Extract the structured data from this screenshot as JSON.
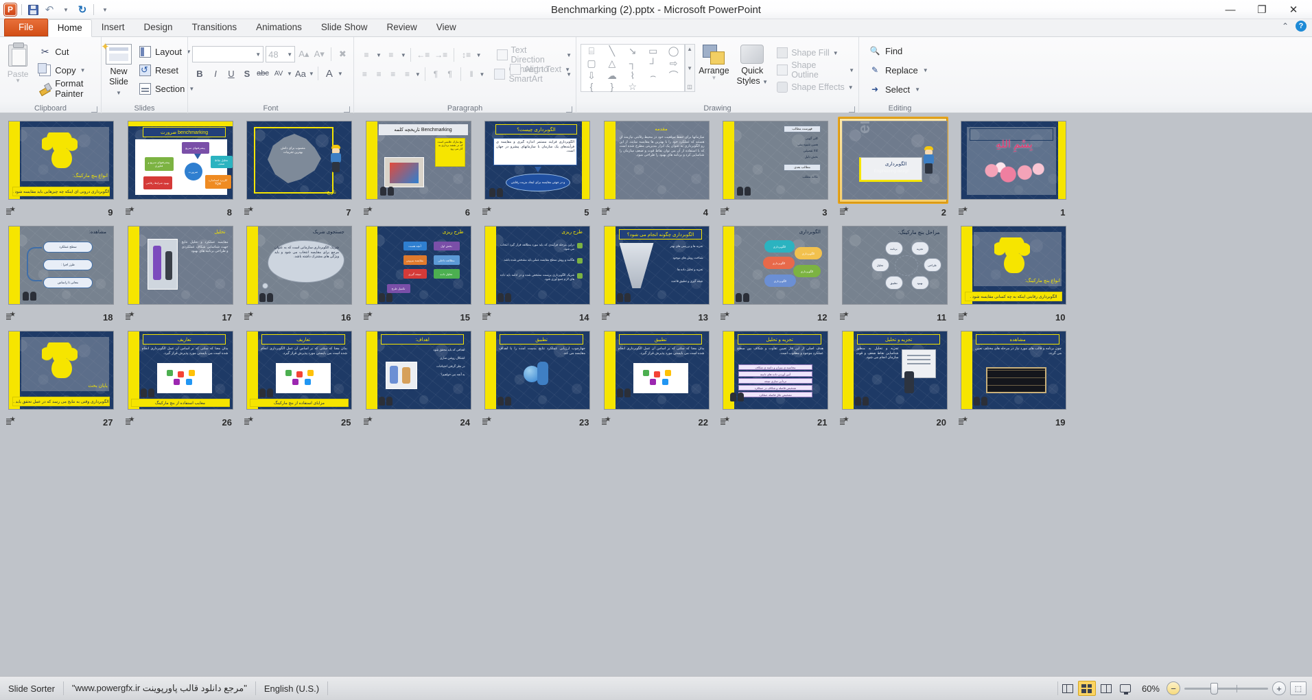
{
  "titlebar": {
    "app_icon": "powerpoint-logo-icon",
    "qat": [
      {
        "name": "save",
        "icon": "save-icon",
        "label": "Save"
      },
      {
        "name": "undo",
        "icon": "undo-icon",
        "label": "Undo"
      },
      {
        "name": "redo",
        "icon": "redo-icon",
        "label": "Repeat"
      },
      {
        "name": "customize",
        "icon": "chevron-down-icon",
        "label": "Customize Quick Access Toolbar"
      }
    ],
    "title": "Benchmarking (2).pptx  -  Microsoft PowerPoint",
    "minimize": "—",
    "restore": "❐",
    "close": "✕",
    "collapse_ribbon": "⌃",
    "help": "?"
  },
  "tabs": [
    {
      "label": "File",
      "active": false,
      "kind": "file"
    },
    {
      "label": "Home",
      "active": true,
      "kind": "normal"
    },
    {
      "label": "Insert",
      "active": false,
      "kind": "normal"
    },
    {
      "label": "Design",
      "active": false,
      "kind": "normal"
    },
    {
      "label": "Transitions",
      "active": false,
      "kind": "normal"
    },
    {
      "label": "Animations",
      "active": false,
      "kind": "normal"
    },
    {
      "label": "Slide Show",
      "active": false,
      "kind": "normal"
    },
    {
      "label": "Review",
      "active": false,
      "kind": "normal"
    },
    {
      "label": "View",
      "active": false,
      "kind": "normal"
    }
  ],
  "ribbon": {
    "groups": {
      "clipboard": {
        "label": "Clipboard",
        "paste": "Paste",
        "cut": "Cut",
        "copy": "Copy",
        "format_painter": "Format Painter"
      },
      "slides": {
        "label": "Slides",
        "new_slide_line1": "New",
        "new_slide_line2": "Slide",
        "layout": "Layout",
        "reset": "Reset",
        "section": "Section"
      },
      "font": {
        "label": "Font",
        "font_name": "",
        "font_size": "48",
        "bold": "B",
        "italic": "I",
        "underline": "U",
        "shadow": "S",
        "strikethrough": "abc",
        "character_spacing": "AV",
        "change_case": "Aa",
        "font_color": "A",
        "increase_size": "A",
        "decrease_size": "A",
        "clear_formatting": "Aa"
      },
      "paragraph": {
        "label": "Paragraph",
        "bullets": "≡",
        "numbering": "≡",
        "decrease_indent": "←≡",
        "increase_indent": "→≡",
        "line_spacing": "↕≡",
        "align_left": "≡",
        "align_center": "≡",
        "align_right": "≡",
        "justify": "≡",
        "ltr": "¶",
        "rtl": "¶",
        "columns": "‖",
        "text_direction": "Text Direction",
        "align_text": "Align Text",
        "convert_to_smartart": "Convert to SmartArt"
      },
      "drawing": {
        "label": "Drawing",
        "shapes": [
          "text-box",
          "line",
          "arrow",
          "rectangle",
          "oval",
          "rounded-rectangle",
          "triangle",
          "elbow-connector",
          "elbow-arrow-connector",
          "right-arrow",
          "down-arrow",
          "cloud-callout",
          "scribble",
          "curve",
          "arc",
          "left-brace",
          "right-brace",
          "star"
        ],
        "arrange": "Arrange",
        "quick_styles_line1": "Quick",
        "quick_styles_line2": "Styles",
        "shape_fill": "Shape Fill",
        "shape_outline": "Shape Outline",
        "shape_effects": "Shape Effects"
      },
      "editing": {
        "label": "Editing",
        "find": "Find",
        "replace": "Replace",
        "select": "Select"
      }
    }
  },
  "statusbar": {
    "view_name": "Slide Sorter",
    "theme_note": "\"مرجع دانلود قالب پاورپوینت www.powergfx.ir\"",
    "language": "English (U.S.)",
    "views": [
      {
        "name": "normal-view",
        "label": "Normal",
        "active": false
      },
      {
        "name": "slide-sorter-view",
        "label": "Slide Sorter",
        "active": true
      },
      {
        "name": "reading-view",
        "label": "Reading View",
        "active": false
      },
      {
        "name": "slide-show-view",
        "label": "Slide Show",
        "active": false
      }
    ],
    "zoom_level": "60%",
    "zoom_out": "−",
    "zoom_in": "+",
    "fit_to_window": "⬚"
  },
  "sorter": {
    "selected_slide": 2,
    "rows": [
      [
        {
          "number": "9",
          "art": "brain-title",
          "title": "انواع بنچ مارکینگ:",
          "caption": "الگوبرداری درونی ای اینکه چه چیزهایی باید مقایسه شود ."
        },
        {
          "number": "8",
          "art": "diagram-flow",
          "title": "benchmarking ضرورت",
          "caption": ""
        },
        {
          "number": "7",
          "art": "gear-map",
          "title": "تاریخ:",
          "caption": ""
        },
        {
          "number": "6",
          "art": "benchmark-kw",
          "title": "Benchmarking تاریخچه کلمه",
          "caption": ""
        },
        {
          "number": "5",
          "art": "oval-def",
          "title": "الگوبرداری چیست؟",
          "caption": ""
        },
        {
          "number": "4",
          "art": "text-dense",
          "title": "مقدمه",
          "caption": ""
        },
        {
          "number": "3",
          "art": "bullets-light",
          "title": "فهرست مطالب",
          "caption": ""
        },
        {
          "number": "2",
          "art": "cover-eng",
          "title": "الگوبرداری",
          "caption": ""
        },
        {
          "number": "1",
          "art": "bismillah",
          "title": "",
          "caption": ""
        }
      ],
      [
        {
          "number": "18",
          "art": "cycle-arrows",
          "title": "مشاهده:",
          "caption": ""
        },
        {
          "number": "17",
          "art": "lab-photo",
          "title": "تحلیل",
          "caption": ""
        },
        {
          "number": "16",
          "art": "thought",
          "title": "جستجوی شریک",
          "caption": ""
        },
        {
          "number": "15",
          "art": "flow-boxes",
          "title": "طرح ریزی",
          "caption": ""
        },
        {
          "number": "14",
          "art": "bullets-check",
          "title": "طرح ریزی",
          "caption": ""
        },
        {
          "number": "13",
          "art": "funnel",
          "title": "الگوبرداری چگونه انجام می شود؟",
          "caption": ""
        },
        {
          "number": "12",
          "art": "color-ovals",
          "title": "الگوبرداری",
          "caption": ""
        },
        {
          "number": "11",
          "art": "circle-net",
          "title": "مراحل بنچ مارکینگ:",
          "caption": ""
        },
        {
          "number": "10",
          "art": "brain-title",
          "title": "انواع بنچ مارکینگ:",
          "caption": "الگوبرداری رقابتی اینکه به چه کسانی مقایسه شود ."
        }
      ],
      [
        {
          "number": "27",
          "art": "brain-title",
          "title": "پایان بحث",
          "caption": "الگوبرداری وقتی به نتایج می رسد که در عمل تحقق یابد ."
        },
        {
          "number": "26",
          "art": "hands-puzzle",
          "title": "تعاریف",
          "caption": "معایب استفاده از بنچ مارکینگ"
        },
        {
          "number": "25",
          "art": "hands-puzzle2",
          "title": "تعاریف",
          "caption": "مزایای استفاده از بنچ مارکینگ"
        },
        {
          "number": "24",
          "art": "people-photo",
          "title": "اهداف:",
          "caption": ""
        },
        {
          "number": "23",
          "art": "globe-figure",
          "title": "تطبیق",
          "caption": ""
        },
        {
          "number": "22",
          "art": "puzzle-hands",
          "title": "تطبیق",
          "caption": ""
        },
        {
          "number": "21",
          "art": "list-purple",
          "title": "تجزیه و تحلیل",
          "caption": ""
        },
        {
          "number": "20",
          "art": "board-person",
          "title": "تجزیه و تحلیل",
          "caption": ""
        },
        {
          "number": "19",
          "art": "dark-table",
          "title": "مشاهده",
          "caption": ""
        }
      ]
    ]
  }
}
